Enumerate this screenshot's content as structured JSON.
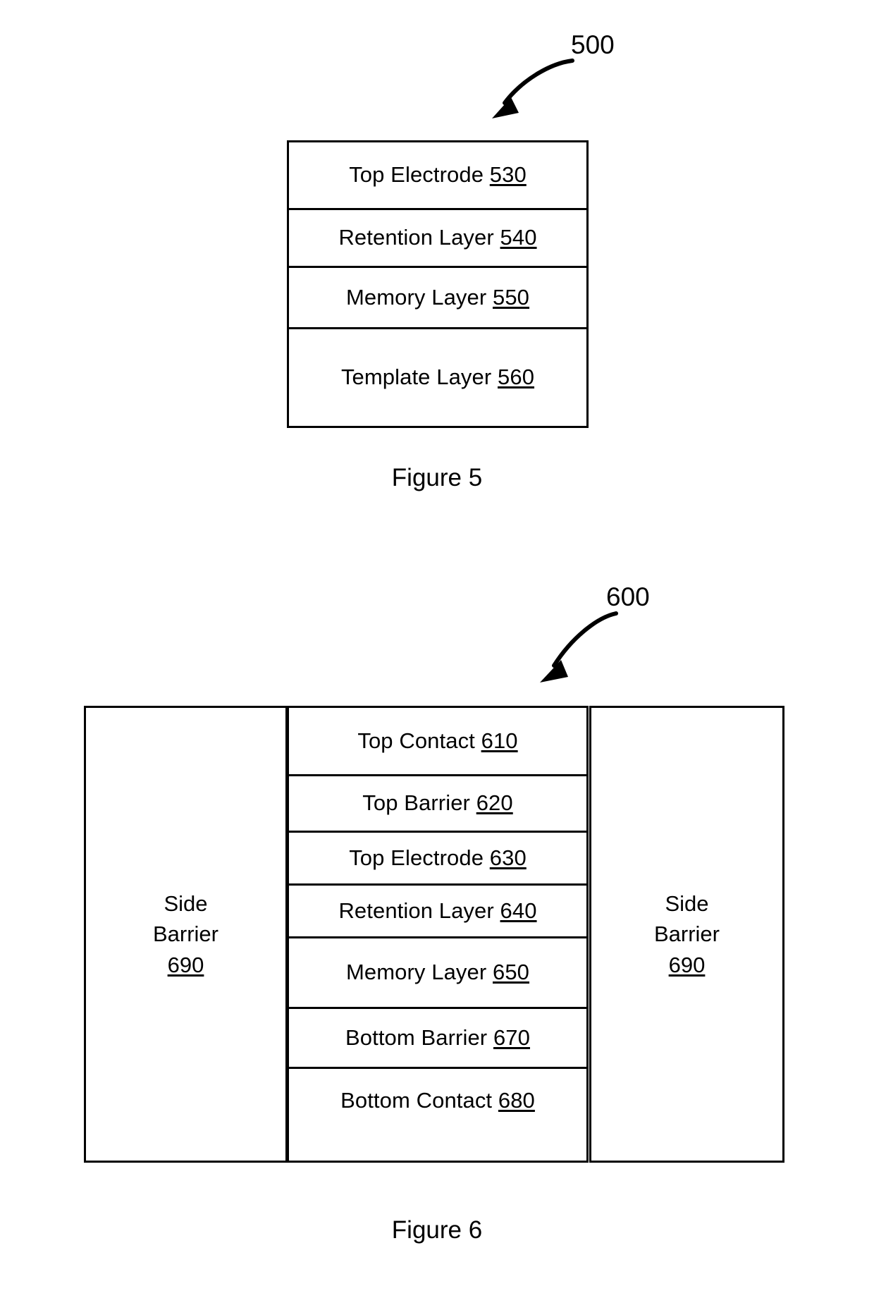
{
  "figures": [
    {
      "id": "fig5",
      "callout": "500",
      "caption": "Figure 5",
      "stack": {
        "layers": [
          {
            "name": "Top Electrode",
            "ref": "530"
          },
          {
            "name": "Retention Layer",
            "ref": "540"
          },
          {
            "name": "Memory Layer",
            "ref": "550"
          },
          {
            "name": "Template Layer",
            "ref": "560"
          }
        ]
      }
    },
    {
      "id": "fig6",
      "callout": "600",
      "caption": "Figure 6",
      "side_barrier_left": {
        "line1": "Side",
        "line2": "Barrier",
        "ref": "690"
      },
      "side_barrier_right": {
        "line1": "Side",
        "line2": "Barrier",
        "ref": "690"
      },
      "stack": {
        "layers": [
          {
            "name": "Top Contact",
            "ref": "610"
          },
          {
            "name": "Top Barrier",
            "ref": "620"
          },
          {
            "name": "Top Electrode",
            "ref": "630"
          },
          {
            "name": "Retention Layer",
            "ref": "640"
          },
          {
            "name": "Memory Layer",
            "ref": "650"
          },
          {
            "name": "Bottom Barrier",
            "ref": "670"
          },
          {
            "name": "Bottom Contact",
            "ref": "680"
          }
        ]
      }
    }
  ],
  "colors": {
    "ink": "#000000",
    "paper": "#ffffff"
  }
}
